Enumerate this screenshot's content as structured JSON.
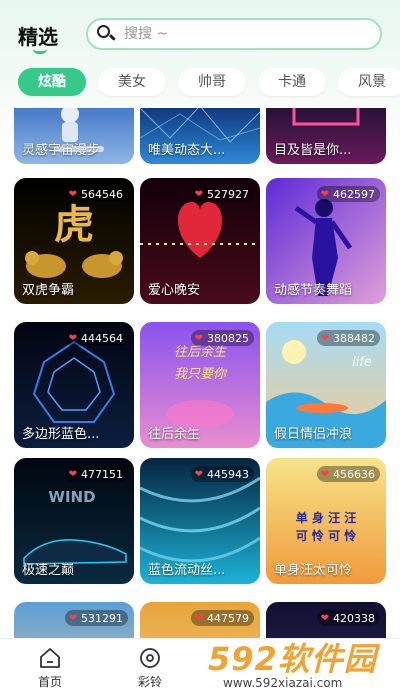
{
  "header": {
    "title": "精选",
    "search_placeholder": "搜搜 ~"
  },
  "tabs": [
    {
      "label": "炫酷",
      "active": true
    },
    {
      "label": "美女"
    },
    {
      "label": "帅哥"
    },
    {
      "label": "卡通"
    },
    {
      "label": "风景"
    }
  ],
  "cards": [
    {
      "name": "灵感宇宙漫步",
      "likes": "",
      "colors": [
        "#3a6fc4",
        "#8fb6e6"
      ]
    },
    {
      "name": "唯美动态大...",
      "likes": "",
      "colors": [
        "#0a2a6e",
        "#2f8ad8"
      ]
    },
    {
      "name": "目及皆是你...",
      "likes": "",
      "colors": [
        "#1c1030",
        "#6a1a5c"
      ]
    },
    {
      "name": "双虎争霸",
      "likes": "564546",
      "colors": [
        "#000000",
        "#2a1c00"
      ]
    },
    {
      "name": "爱心晚安",
      "likes": "527927",
      "colors": [
        "#12000a",
        "#4a0a1a"
      ]
    },
    {
      "name": "动感节奏舞蹈",
      "likes": "462597",
      "colors": [
        "#5d2ad8",
        "#e0a0d8"
      ]
    },
    {
      "name": "多边形蓝色...",
      "likes": "444564",
      "colors": [
        "#020512",
        "#0c1e3e"
      ]
    },
    {
      "name": "往后余生",
      "likes": "380825",
      "colors": [
        "#8a52ee",
        "#e88ed0"
      ]
    },
    {
      "name": "假日情侣冲浪",
      "likes": "388482",
      "colors": [
        "#a6dcf5",
        "#f2c98f"
      ]
    },
    {
      "name": "极速之巅",
      "likes": "477151",
      "colors": [
        "#01060f",
        "#0a2a40"
      ]
    },
    {
      "name": "蓝色流动丝...",
      "likes": "445943",
      "colors": [
        "#06243f",
        "#1cb3d8"
      ]
    },
    {
      "name": "单身汪太可怜",
      "likes": "456636",
      "colors": [
        "#f7e48a",
        "#f19a3b"
      ]
    },
    {
      "name": "",
      "likes": "531291",
      "colors": [
        "#5a9fd6",
        "#f0c7a0"
      ]
    },
    {
      "name": "",
      "likes": "447579",
      "colors": [
        "#e8a43a",
        "#f5d08a"
      ]
    },
    {
      "name": "",
      "likes": "420338",
      "colors": [
        "#101030",
        "#3a2a6a"
      ]
    }
  ],
  "card_art": {
    "tiger_glyph": "虎",
    "valentine_text_1": "往后余生",
    "valentine_text_2": "我只要你",
    "surf_text": "life",
    "car_text": "WIND",
    "dog_text_1": "单 身 汪 汪",
    "dog_text_2": "可 怜 可 怜"
  },
  "bottom_nav": [
    {
      "label": "首页",
      "icon": "home-icon"
    },
    {
      "label": "彩铃",
      "icon": "ringtone-disc-icon"
    }
  ],
  "watermark": {
    "logo": "592软件园",
    "url": "www.592xiazai.com"
  }
}
